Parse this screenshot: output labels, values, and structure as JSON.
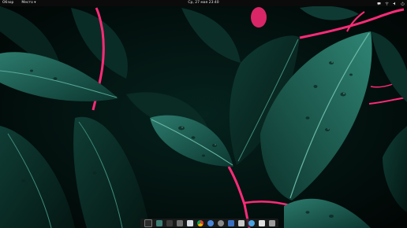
{
  "topbar": {
    "activities_label": "Обзор",
    "apps_menu_label": "Место ▾",
    "clock": "Ср, 27 мая 23:40",
    "tray_icons": [
      "chat-icon",
      "network-icon",
      "volume-icon",
      "power-icon"
    ]
  },
  "dock": {
    "apps": [
      {
        "name": "show-apps-icon",
        "color": "#2b2b2b"
      },
      {
        "name": "image-viewer-icon",
        "color": "#3e7d74"
      },
      {
        "name": "terminal-icon",
        "color": "#3a3a3a"
      },
      {
        "name": "files-icon",
        "color": "#6f6f6f"
      },
      {
        "name": "text-editor-icon",
        "color": "#d8dde3"
      },
      {
        "name": "chrome-icon",
        "color": "#e7b22f"
      },
      {
        "name": "software-center-icon",
        "color": "#4a86d8"
      },
      {
        "name": "settings-icon",
        "color": "#8a8a8a"
      },
      {
        "name": "monitor-icon",
        "color": "#3a6fbf"
      },
      {
        "name": "photos-icon",
        "color": "#c9c9c9"
      },
      {
        "name": "web-browser-icon",
        "color": "#4aa3df"
      },
      {
        "name": "calendar-icon",
        "color": "#e0e0e0"
      },
      {
        "name": "trash-icon",
        "color": "#9c9c9c"
      }
    ]
  },
  "colors": {
    "stem": "#ff2a78",
    "leaf_dark": "#0d3a33",
    "leaf_light": "#2c7a6c",
    "vein": "#58a897"
  }
}
